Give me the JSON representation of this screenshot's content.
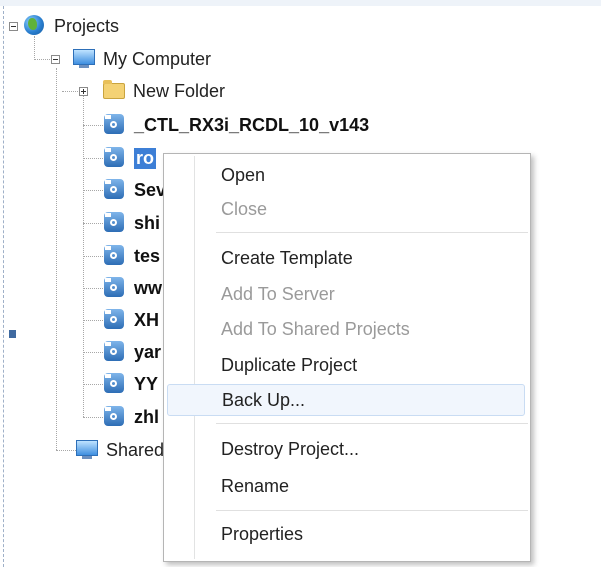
{
  "tree": {
    "root": {
      "label": "Projects",
      "icon": "globe-icon"
    },
    "computer": {
      "label": "My Computer",
      "icon": "computer-icon"
    },
    "folder": {
      "label": "New Folder",
      "icon": "folder-icon"
    },
    "projects": [
      {
        "label": "_CTL_RX3i_RCDL_10_v143"
      },
      {
        "label": "ro"
      },
      {
        "label": "Sev"
      },
      {
        "label": "shi"
      },
      {
        "label": "tes"
      },
      {
        "label": "ww"
      },
      {
        "label": "XH"
      },
      {
        "label": "yar"
      },
      {
        "label": "YY"
      },
      {
        "label": "zhl"
      }
    ],
    "shared": {
      "label": "Shared",
      "icon": "computer-icon"
    }
  },
  "context_menu": {
    "items": [
      {
        "label": "Open",
        "enabled": true
      },
      {
        "label": "Close",
        "enabled": false
      },
      {
        "label": "Create Template",
        "enabled": true
      },
      {
        "label": "Add To Server",
        "enabled": false
      },
      {
        "label": "Add To Shared Projects",
        "enabled": false
      },
      {
        "label": "Duplicate Project",
        "enabled": true
      },
      {
        "label": "Back Up...",
        "enabled": true,
        "hovered": true
      },
      {
        "label": "Destroy Project...",
        "enabled": true
      },
      {
        "label": "Rename",
        "enabled": true
      },
      {
        "label": "Properties",
        "enabled": true
      }
    ]
  },
  "colors": {
    "selection": "#3d7fd6",
    "menu_hover": "#f1f6fd",
    "disabled_text": "#9a9a9a"
  }
}
